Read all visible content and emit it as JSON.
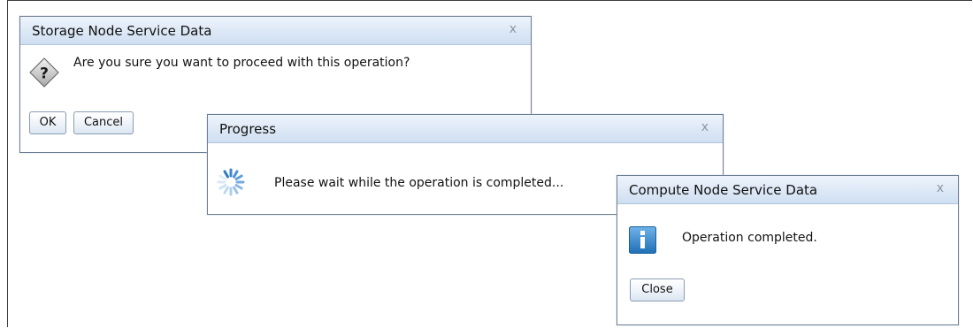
{
  "dialogs": {
    "storage": {
      "title": "Storage Node Service Data",
      "close_glyph": "x",
      "message": "Are you sure you want to proceed with this operation?",
      "icon": "question-icon",
      "buttons": {
        "ok": "OK",
        "cancel": "Cancel"
      }
    },
    "progress": {
      "title": "Progress",
      "close_glyph": "x",
      "message": "Please wait while the operation is completed...",
      "icon": "spinner-icon"
    },
    "compute": {
      "title": "Compute Node Service Data",
      "close_glyph": "x",
      "message": "Operation completed.",
      "icon": "info-icon",
      "buttons": {
        "close": "Close"
      }
    }
  },
  "colors": {
    "titlebar": "#dde8f6",
    "border": "#6f7f92",
    "info_icon": "#2b7fc4",
    "spinner": "#4a90d0"
  }
}
